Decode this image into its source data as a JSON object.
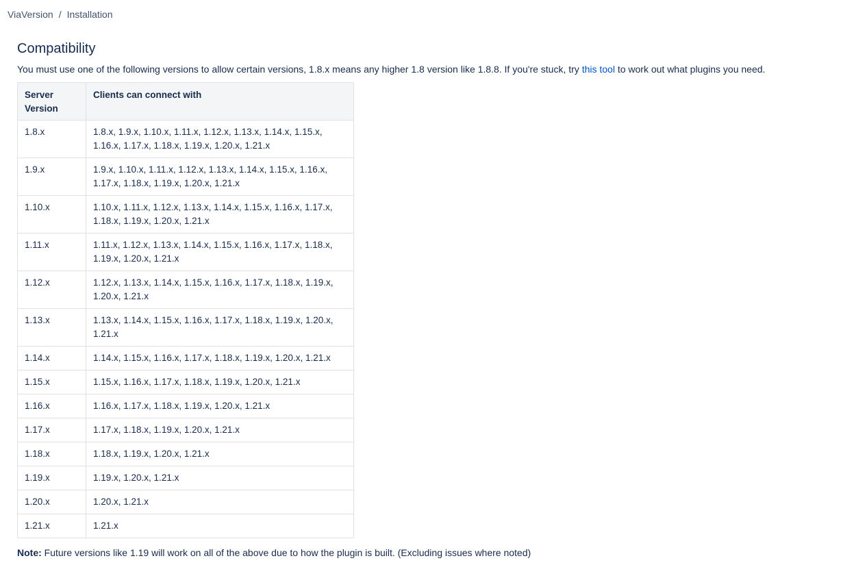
{
  "breadcrumb": {
    "items": [
      "ViaVersion",
      "Installation"
    ],
    "separator": "/"
  },
  "page": {
    "heading": "Compatibility",
    "intro_before_link": "You must use one of the following versions to allow certain versions, 1.8.x means any higher 1.8 version like 1.8.8. If you're stuck, try ",
    "intro_link": "this tool",
    "intro_after_link": " to work out what plugins you need.",
    "note_label": "Note:",
    "note_text": " Future versions like 1.19 will work on all of the above due to how the plugin is built. (Excluding issues where noted)"
  },
  "table": {
    "headers": [
      "Server Version",
      "Clients can connect with"
    ],
    "rows": [
      {
        "server": "1.8.x",
        "clients": "1.8.x, 1.9.x, 1.10.x, 1.11.x, 1.12.x, 1.13.x, 1.14.x, 1.15.x, 1.16.x, 1.17.x, 1.18.x, 1.19.x, 1.20.x, 1.21.x"
      },
      {
        "server": "1.9.x",
        "clients": "1.9.x, 1.10.x, 1.11.x, 1.12.x, 1.13.x, 1.14.x, 1.15.x, 1.16.x, 1.17.x, 1.18.x, 1.19.x, 1.20.x, 1.21.x"
      },
      {
        "server": "1.10.x",
        "clients": "1.10.x, 1.11.x, 1.12.x, 1.13.x, 1.14.x, 1.15.x, 1.16.x, 1.17.x, 1.18.x, 1.19.x, 1.20.x, 1.21.x"
      },
      {
        "server": "1.11.x",
        "clients": "1.11.x, 1.12.x, 1.13.x, 1.14.x, 1.15.x, 1.16.x, 1.17.x, 1.18.x, 1.19.x, 1.20.x, 1.21.x"
      },
      {
        "server": "1.12.x",
        "clients": "1.12.x, 1.13.x, 1.14.x, 1.15.x, 1.16.x, 1.17.x, 1.18.x, 1.19.x, 1.20.x, 1.21.x"
      },
      {
        "server": "1.13.x",
        "clients": "1.13.x, 1.14.x, 1.15.x, 1.16.x, 1.17.x, 1.18.x, 1.19.x, 1.20.x, 1.21.x"
      },
      {
        "server": "1.14.x",
        "clients": "1.14.x, 1.15.x, 1.16.x, 1.17.x, 1.18.x, 1.19.x, 1.20.x, 1.21.x"
      },
      {
        "server": "1.15.x",
        "clients": "1.15.x, 1.16.x, 1.17.x, 1.18.x, 1.19.x, 1.20.x, 1.21.x"
      },
      {
        "server": "1.16.x",
        "clients": "1.16.x, 1.17.x, 1.18.x, 1.19.x, 1.20.x, 1.21.x"
      },
      {
        "server": "1.17.x",
        "clients": "1.17.x, 1.18.x, 1.19.x, 1.20.x, 1.21.x"
      },
      {
        "server": "1.18.x",
        "clients": "1.18.x, 1.19.x, 1.20.x, 1.21.x"
      },
      {
        "server": "1.19.x",
        "clients": "1.19.x, 1.20.x, 1.21.x"
      },
      {
        "server": "1.20.x",
        "clients": "1.20.x, 1.21.x"
      },
      {
        "server": "1.21.x",
        "clients": "1.21.x"
      }
    ]
  },
  "colors": {
    "link": "#0052cc",
    "text": "#172b4d",
    "header_bg": "#f4f5f7",
    "border": "#dfe1e6"
  }
}
